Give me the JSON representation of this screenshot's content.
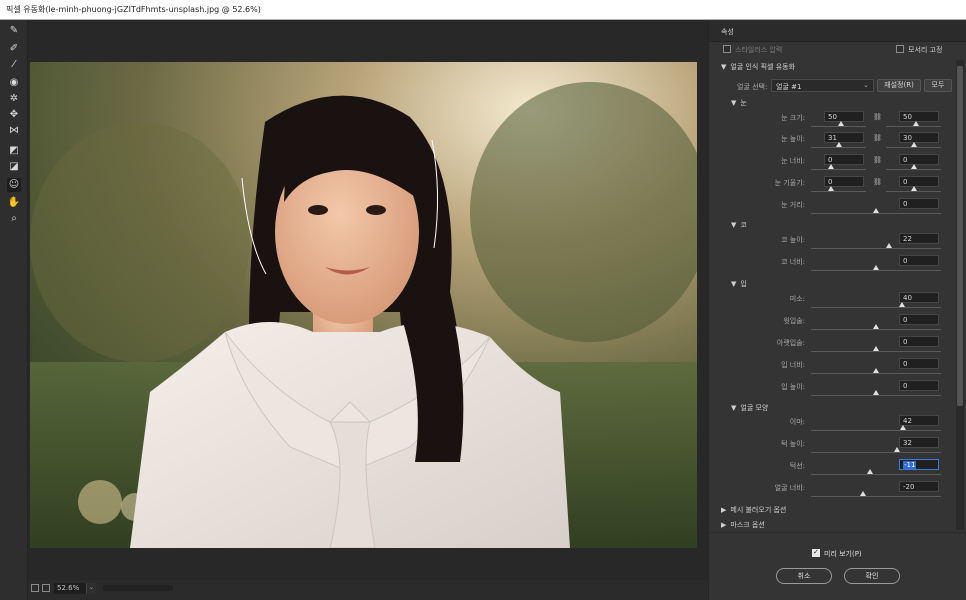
{
  "title": "픽셀 유동화(le-minh-phuong-jGZITdFhmts-unsplash.jpg @ 52.6%)",
  "tools": [
    {
      "icon": "warp-icon",
      "glyph": "✎"
    },
    {
      "icon": "reconstruct-icon",
      "glyph": "✐"
    },
    {
      "icon": "smooth-icon",
      "glyph": "⁄"
    },
    {
      "icon": "twirl-icon",
      "glyph": "◉"
    },
    {
      "icon": "pucker-icon",
      "glyph": "✲"
    },
    {
      "icon": "bloat-icon",
      "glyph": "✥"
    },
    {
      "icon": "push-left-icon",
      "glyph": "⋈"
    },
    {
      "icon": "freeze-mask-icon",
      "glyph": "◩"
    },
    {
      "icon": "thaw-mask-icon",
      "glyph": "◪"
    },
    {
      "icon": "face-tool-icon",
      "glyph": "☺"
    },
    {
      "icon": "hand-icon",
      "glyph": "✋"
    },
    {
      "icon": "zoom-icon",
      "glyph": "⌕"
    }
  ],
  "footer": {
    "zoom": "52.6%",
    "zoom_arrow": "⌄"
  },
  "panel": {
    "header": "속성",
    "stylus": "스타일러스 압력",
    "pin_edges": "모서리 고정",
    "face_aware": "얼굴 인식 픽셀 유동화",
    "face_select_label": "얼굴 선택:",
    "face_select_value": "얼굴 #1",
    "reset": "재설정(R)",
    "all": "모두",
    "eyes": {
      "title": "눈",
      "rows": [
        {
          "label": "눈 크기:",
          "left": "50",
          "right": "50",
          "lpos": 0.55,
          "rpos": 0.55
        },
        {
          "label": "눈 높이:",
          "left": "31",
          "right": "30",
          "lpos": 0.5,
          "rpos": 0.5
        },
        {
          "label": "눈 너비:",
          "left": "0",
          "right": "0",
          "lpos": 0.37,
          "rpos": 0.5
        },
        {
          "label": "눈 기울기:",
          "left": "0",
          "right": "0",
          "lpos": 0.37,
          "rpos": 0.5
        }
      ],
      "distance": {
        "label": "눈 거리:",
        "value": "0",
        "pos": 0.5
      }
    },
    "nose": {
      "title": "코",
      "rows": [
        {
          "label": "코 높이:",
          "value": "22",
          "pos": 0.6
        },
        {
          "label": "코 너비:",
          "value": "0",
          "pos": 0.5
        }
      ]
    },
    "mouth": {
      "title": "입",
      "rows": [
        {
          "label": "미소:",
          "value": "40",
          "pos": 0.7
        },
        {
          "label": "윗입술:",
          "value": "0",
          "pos": 0.5
        },
        {
          "label": "아랫입술:",
          "value": "0",
          "pos": 0.5
        },
        {
          "label": "입 너비:",
          "value": "0",
          "pos": 0.5
        },
        {
          "label": "입 높이:",
          "value": "0",
          "pos": 0.5
        }
      ]
    },
    "face_shape": {
      "title": "얼굴 모양",
      "rows": [
        {
          "label": "이마:",
          "value": "42",
          "pos": 0.71
        },
        {
          "label": "턱 높이:",
          "value": "32",
          "pos": 0.66
        },
        {
          "label": "턱선:",
          "value": "-11",
          "pos": 0.45,
          "highlight": true
        },
        {
          "label": "얼굴 너비:",
          "value": "-20",
          "pos": 0.4
        }
      ]
    },
    "mesh_options": "메시 불러오기 옵션",
    "mask_options": "마스크 옵션",
    "preview": "미리 보기(P)",
    "cancel": "취소",
    "ok": "확인"
  }
}
